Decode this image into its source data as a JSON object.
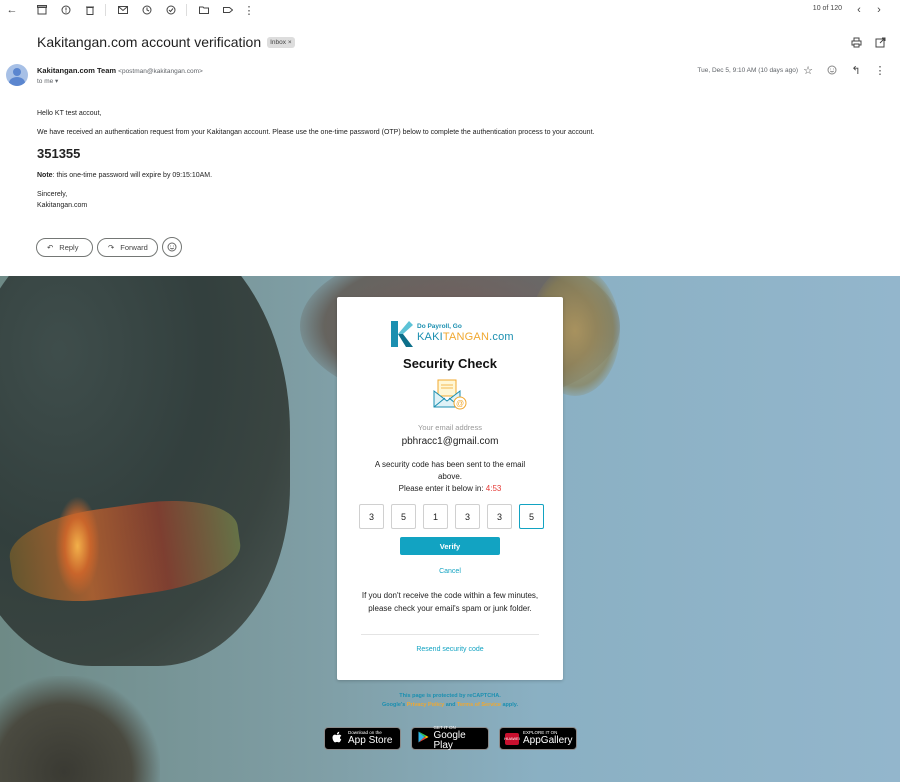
{
  "toolbar": {
    "counter": "10 of 120"
  },
  "email": {
    "subject": "Kakitangan.com account verification",
    "label": "Inbox ×",
    "sender_name": "Kakitangan.com Team",
    "sender_address": "<postman@kakitangan.com>",
    "to": "to me ▾",
    "date": "Tue, Dec 5, 9:10 AM (10 days ago)",
    "greeting": "Hello KT test accout,",
    "message": "We have received an authentication request from your Kakitangan account. Please use the one-time password (OTP) below to complete the authentication process to your account.",
    "otp": "351355",
    "note_label": "Note",
    "note_text": ": this one-time password will expire by 09:15:10AM.",
    "signoff": "Sincerely,",
    "signature": "Kakitangan.com",
    "reply_label": "Reply",
    "forward_label": "Forward"
  },
  "card": {
    "logo_tag": "Do Payroll, Go",
    "logo_pre": "KAKI",
    "logo_hl": "TANGAN",
    "logo_post": ".com",
    "title": "Security Check",
    "email_label": "Your email address",
    "email_value": "pbhracc1@gmail.com",
    "sent_msg": "A security code has been sent to the email above.",
    "enter_msg": "Please enter it below in: ",
    "timer": "4:53",
    "code": [
      "3",
      "5",
      "1",
      "3",
      "3",
      "5"
    ],
    "verify_label": "Verify",
    "cancel_label": "Cancel",
    "help_msg": "If you don't receive the code within a few minutes, please check your email's spam or junk folder.",
    "resend_label": "Resend security code"
  },
  "footer": {
    "recaptcha_line1": "This page is protected by reCAPTCHA.",
    "recaptcha_pre": "Google's ",
    "privacy_label": "Privacy Policy",
    "and": " and ",
    "terms_label": "Terms of Service",
    "apply": " apply."
  },
  "stores": {
    "apple_small": "Download on the",
    "apple_big": "App Store",
    "google_small": "GET IT ON",
    "google_big": "Google Play",
    "huawei_small": "EXPLORE IT ON",
    "huawei_big": "AppGallery",
    "huawei_badge": "HUAWEI"
  },
  "colors": {
    "accent": "#12a3c2",
    "timer": "#e53935",
    "brand_orange": "#f0a830"
  }
}
